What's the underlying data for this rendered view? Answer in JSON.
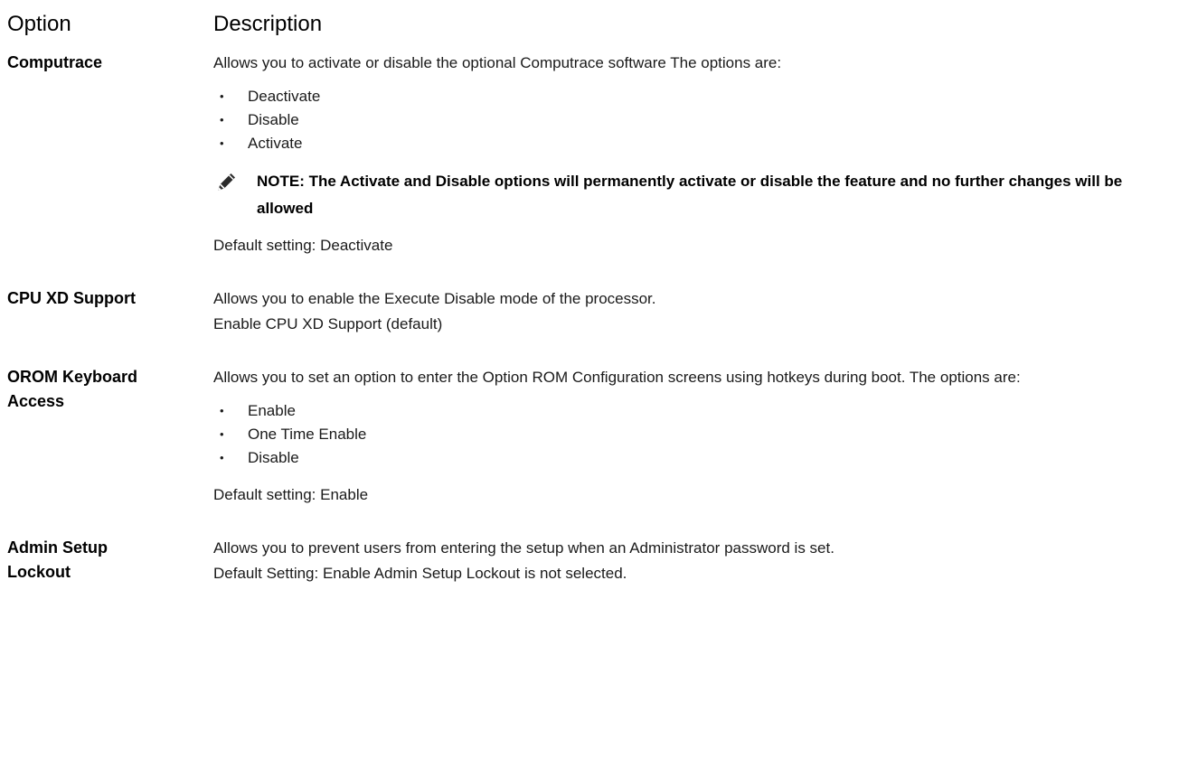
{
  "header": {
    "option": "Option",
    "description": "Description"
  },
  "rows": [
    {
      "option": "Computrace",
      "intro": "Allows you to activate or disable the optional Computrace software The options are:",
      "options": [
        "Deactivate",
        "Disable",
        "Activate"
      ],
      "note": "NOTE: The Activate and Disable options will permanently activate or disable the feature and no further changes will be allowed",
      "default": "Default setting: Deactivate"
    },
    {
      "option": "CPU XD Support",
      "intro": "Allows you to enable the Execute Disable mode of the processor.",
      "default": "Enable CPU XD Support (default)"
    },
    {
      "option": "OROM Keyboard Access",
      "intro": "Allows you to set an option to enter the Option ROM Configuration screens using hotkeys during boot. The options are:",
      "options": [
        "Enable",
        "One Time Enable",
        "Disable"
      ],
      "default": "Default setting: Enable"
    },
    {
      "option": "Admin Setup Lockout",
      "intro": "Allows you to prevent users from entering the setup when an Administrator password is set.",
      "default": "Default Setting: Enable Admin Setup Lockout is not selected."
    }
  ],
  "bullet_glyph": "•",
  "icons": {
    "note": "pencil-icon"
  }
}
